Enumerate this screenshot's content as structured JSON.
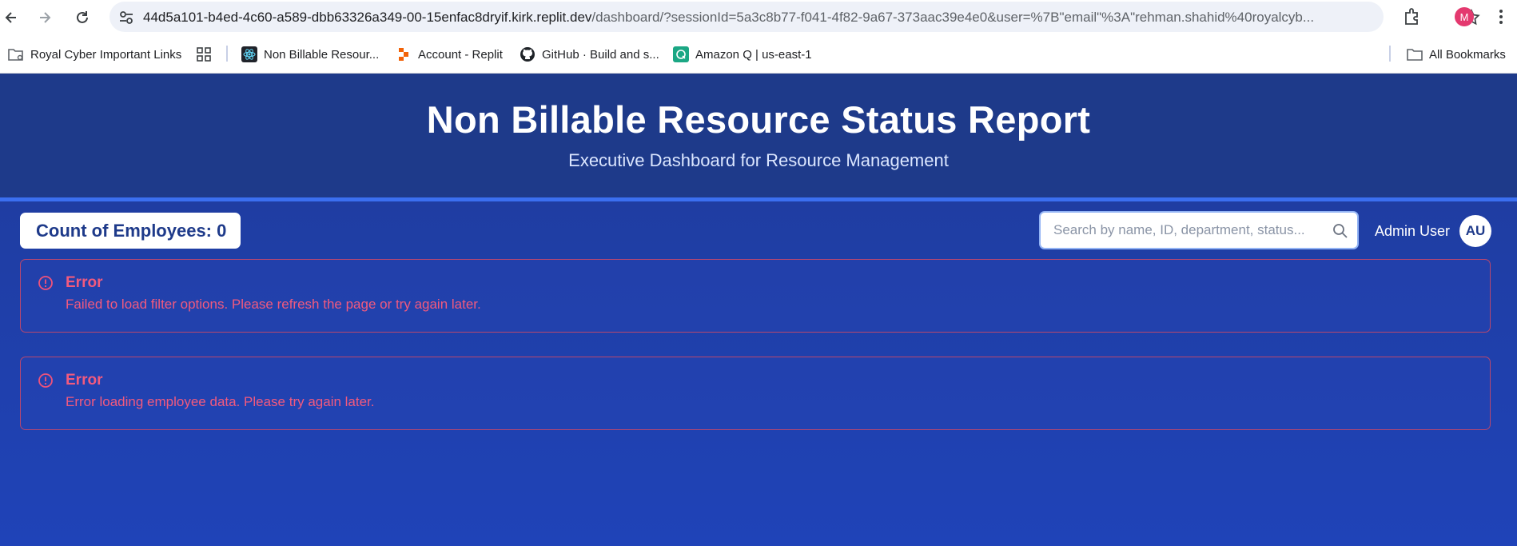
{
  "browser": {
    "url_host": "44d5a101-b4ed-4c60-a589-dbb63326a349-00-15enfac8dryif.kirk.replit.dev",
    "url_rest": "/dashboard/?sessionId=5a3c8b77-f041-4f82-9a67-373aac39e4e0&user=%7B\"email\"%3A\"rehman.shahid%40royalcyb...",
    "profile_initial": "M",
    "bookmarks": [
      {
        "label": "Royal Cyber Important Links",
        "icon": "folder-gear-icon"
      },
      {
        "label": "Non Billable Resour...",
        "icon": "react-icon"
      },
      {
        "label": "Account - Replit",
        "icon": "replit-icon"
      },
      {
        "label": "GitHub · Build and s...",
        "icon": "github-icon"
      },
      {
        "label": "Amazon Q | us-east-1",
        "icon": "amazon-q-icon"
      }
    ],
    "all_bookmarks_label": "All Bookmarks"
  },
  "header": {
    "title": "Non Billable Resource Status Report",
    "subtitle": "Executive Dashboard for Resource Management"
  },
  "toolbar": {
    "count_label": "Count of Employees: 0",
    "search_placeholder": "Search by name, ID, department, status...",
    "user_name": "Admin User",
    "avatar_initials": "AU"
  },
  "errors": [
    {
      "title": "Error",
      "message": "Failed to load filter options. Please refresh the page or try again later."
    },
    {
      "title": "Error",
      "message": "Error loading employee data. Please try again later."
    }
  ],
  "colors": {
    "header_bg": "#1e3a8a",
    "accent": "#3b6ff0",
    "error_text": "#f25a7e"
  }
}
